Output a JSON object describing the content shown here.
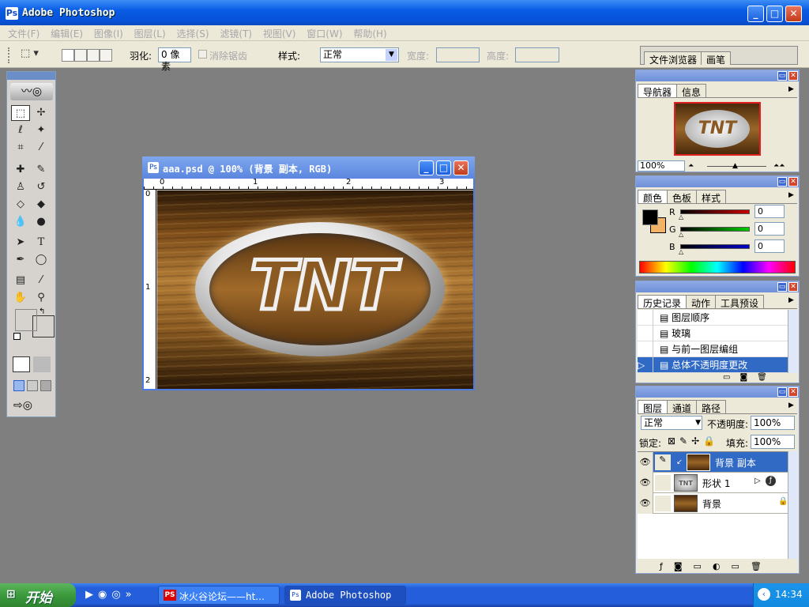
{
  "window": {
    "title": "Adobe Photoshop",
    "min": "_",
    "max": "□",
    "close": "✕"
  },
  "menu": [
    "文件(F)",
    "编辑(E)",
    "图像(I)",
    "图层(L)",
    "选择(S)",
    "滤镜(T)",
    "视图(V)",
    "窗口(W)",
    "帮助(H)"
  ],
  "options": {
    "feather_label": "羽化:",
    "feather_value": "0 像素",
    "antialias_label": "消除锯齿",
    "style_label": "样式:",
    "style_value": "正常",
    "width_label": "宽度:",
    "height_label": "高度:",
    "well_tabs": [
      "文件浏览器",
      "画笔"
    ]
  },
  "document": {
    "title": "aaa.psd @ 100% (背景 副本, RGB)",
    "ruler_h": [
      "0",
      "1",
      "2",
      "3"
    ],
    "ruler_v": [
      "0",
      "1",
      "2"
    ],
    "logo_text": "TNT"
  },
  "navigator": {
    "tabs": [
      "导航器",
      "信息"
    ],
    "zoom": "100%",
    "thumb_text": "TNT"
  },
  "color": {
    "tabs": [
      "颜色",
      "色板",
      "样式"
    ],
    "channels": [
      {
        "label": "R",
        "value": "0",
        "color": "#cc0000"
      },
      {
        "label": "G",
        "value": "0",
        "color": "#00aa00"
      },
      {
        "label": "B",
        "value": "0",
        "color": "#0000cc"
      }
    ],
    "foreground": "#000000",
    "background": "#f2b366"
  },
  "history": {
    "tabs": [
      "历史记录",
      "动作",
      "工具预设"
    ],
    "items": [
      "图层顺序",
      "玻璃",
      "与前一图层编组",
      "总体不透明度更改"
    ],
    "selected_index": 3
  },
  "layers": {
    "tabs": [
      "图层",
      "通道",
      "路径"
    ],
    "blend": "正常",
    "opacity_label": "不透明度:",
    "opacity": "100%",
    "lock_label": "锁定:",
    "fill_label": "填充:",
    "fill": "100%",
    "items": [
      {
        "name": "背景 副本",
        "selected": true
      },
      {
        "name": "形状 1",
        "selected": false
      },
      {
        "name": "背景",
        "selected": false
      }
    ]
  },
  "taskbar": {
    "start": "开始",
    "items": [
      "冰火谷论坛——ht...",
      "Adobe Photoshop"
    ],
    "clock": "14:34"
  }
}
